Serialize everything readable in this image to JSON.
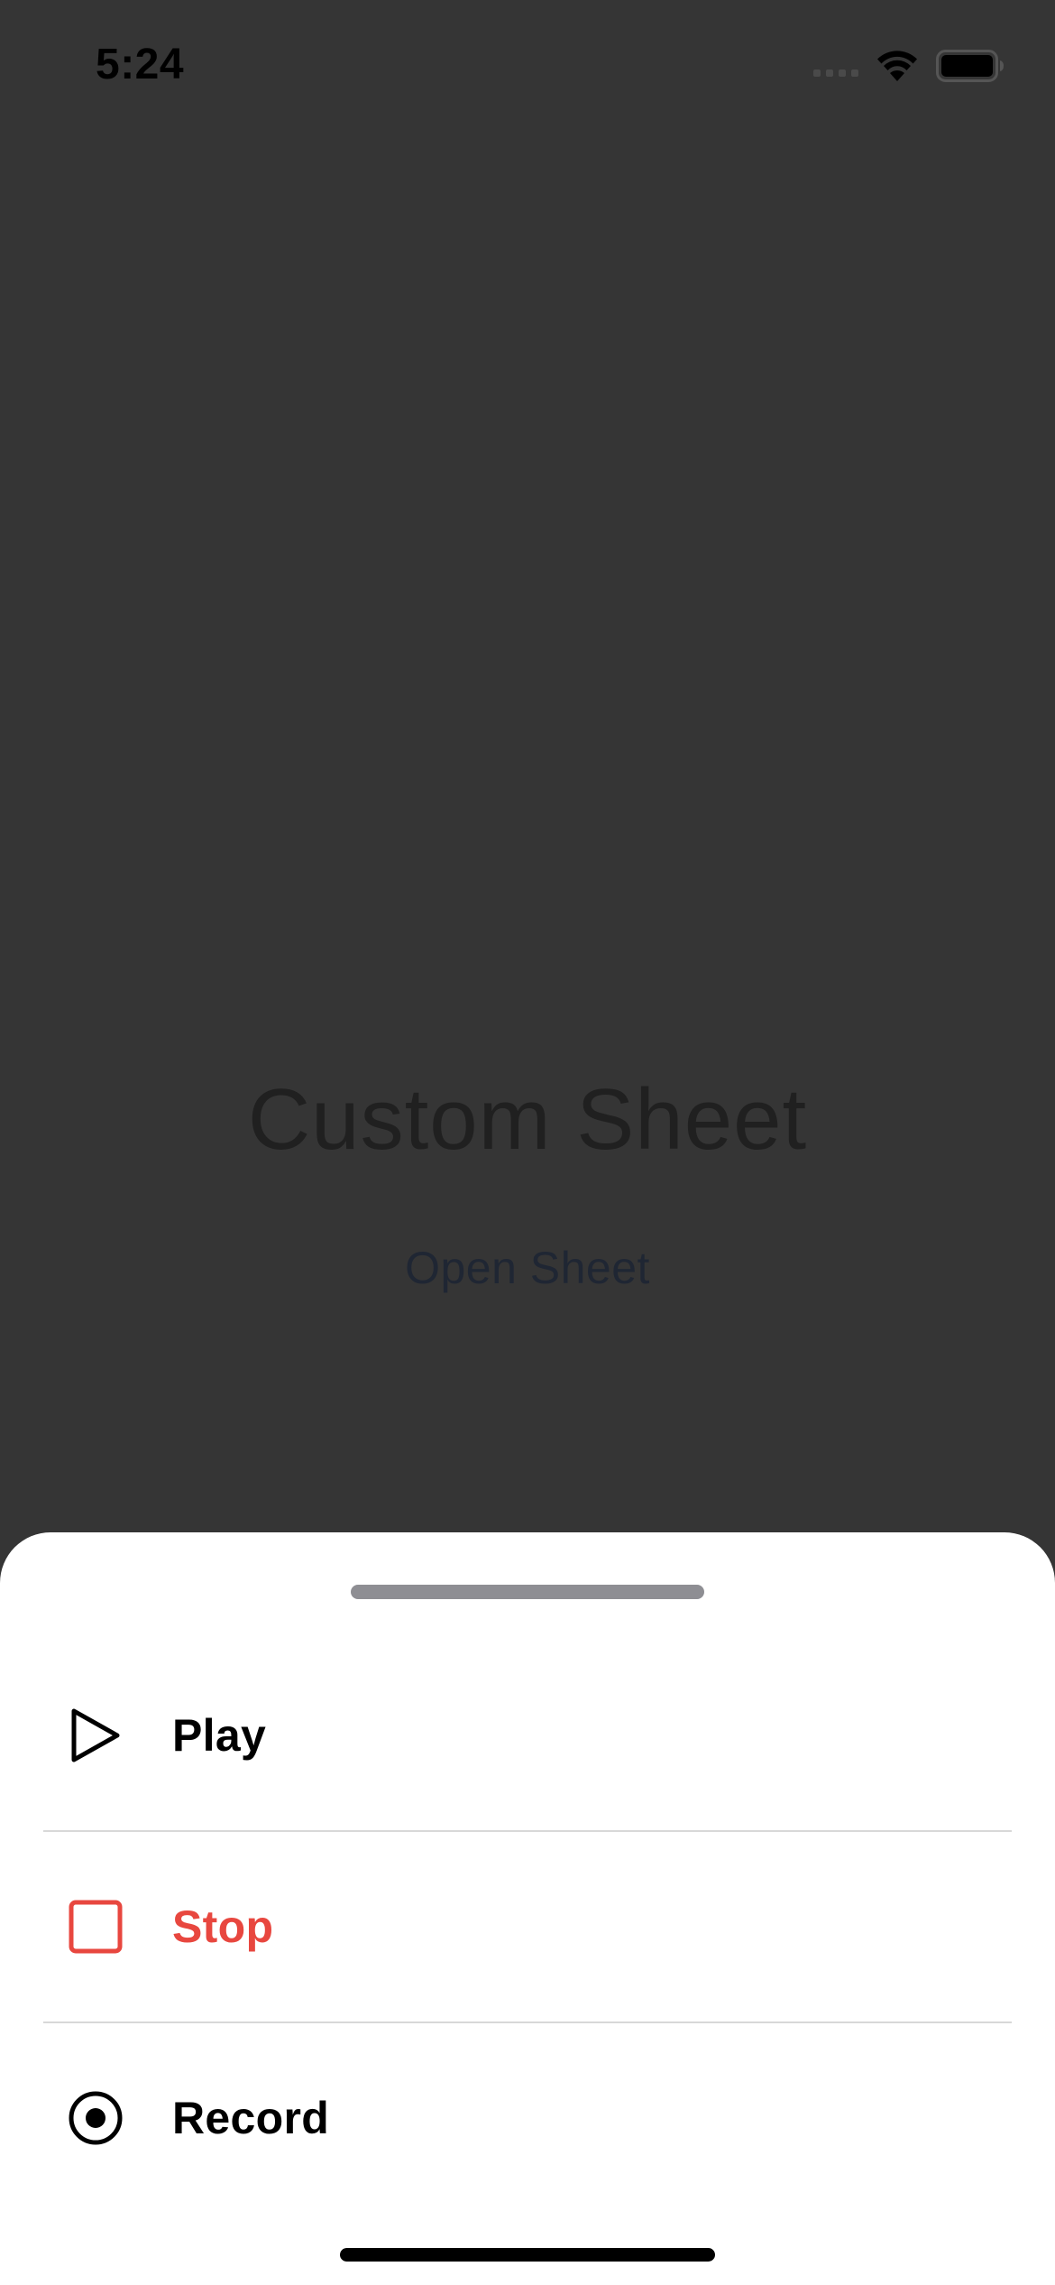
{
  "status_bar": {
    "time": "5:24"
  },
  "background": {
    "title": "Custom Sheet",
    "open_sheet_label": "Open Sheet"
  },
  "sheet": {
    "items": [
      {
        "label": "Play",
        "icon": "play-icon",
        "style": "default"
      },
      {
        "label": "Stop",
        "icon": "stop-icon",
        "style": "destructive"
      },
      {
        "label": "Record",
        "icon": "record-icon",
        "style": "default"
      }
    ]
  },
  "colors": {
    "dimmed_background": "#353535",
    "sheet_background": "#ffffff",
    "destructive": "#e8473f",
    "grabber": "#8e8e93",
    "separator": "#d8d8d8"
  }
}
